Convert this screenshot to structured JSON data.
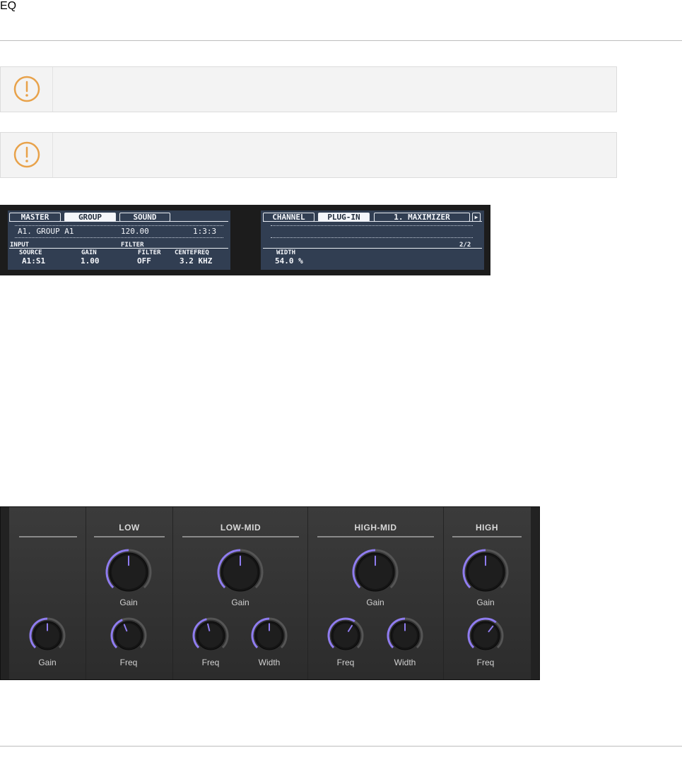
{
  "notices": [
    {
      "icon": "warning-icon",
      "color": "#e8a24a"
    },
    {
      "icon": "warning-icon",
      "color": "#e8a24a"
    }
  ],
  "hardware": {
    "left": {
      "tabs": [
        "MASTER",
        "GROUP",
        "SOUND"
      ],
      "selected_tab": "GROUP",
      "group_name": "A1. GROUP A1",
      "tempo": "120.00",
      "position": "1:3:3",
      "section_input": "INPUT",
      "section_filter": "FILTER",
      "params": [
        {
          "label": "SOURCE",
          "value": "A1:S1"
        },
        {
          "label": "GAIN",
          "value": "1.00"
        },
        {
          "label": "FILTER",
          "value": "OFF"
        },
        {
          "label": "CENTEFREQ",
          "value": "3.2 KHZ"
        }
      ]
    },
    "right": {
      "tabs": [
        "CHANNEL",
        "PLUG-IN",
        "1. MAXIMIZER"
      ],
      "selected_tab": "PLUG-IN",
      "page": "2/2",
      "param_label": "WIDTH",
      "param_value": "54.0 %"
    }
  },
  "eq": {
    "title": "EQ",
    "accent": "#8f7cf0",
    "sections": [
      {
        "title": "",
        "knobs": [
          {
            "label": "Gain",
            "value": 0.5
          }
        ]
      },
      {
        "title": "LOW",
        "knobs": [
          {
            "label": "Gain",
            "value": 0.5
          },
          {
            "label": "Freq",
            "value": 0.42
          }
        ]
      },
      {
        "title": "LOW-MID",
        "knobs": [
          {
            "label": "Gain",
            "value": 0.5
          },
          {
            "label": "Freq",
            "value": 0.45
          },
          {
            "label": "Width",
            "value": 0.5
          }
        ]
      },
      {
        "title": "HIGH-MID",
        "knobs": [
          {
            "label": "Gain",
            "value": 0.5
          },
          {
            "label": "Freq",
            "value": 0.62
          },
          {
            "label": "Width",
            "value": 0.5
          }
        ]
      },
      {
        "title": "HIGH",
        "knobs": [
          {
            "label": "Gain",
            "value": 0.5
          },
          {
            "label": "Freq",
            "value": 0.64
          }
        ]
      }
    ]
  }
}
